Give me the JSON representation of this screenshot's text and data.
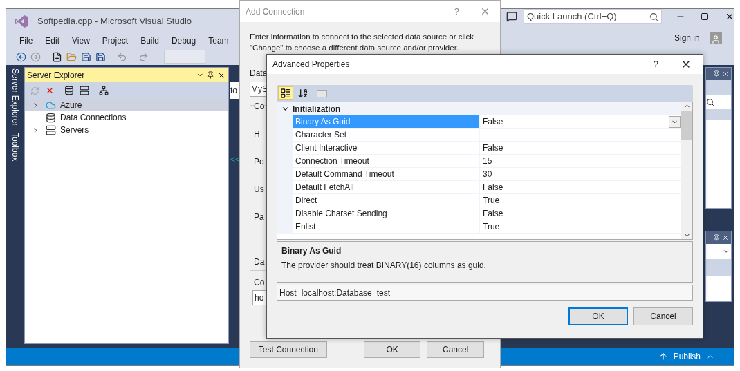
{
  "vs_window": {
    "title": "Softpedia.cpp - Microsoft Visual Studio",
    "quick_launch": {
      "placeholder": "Quick Launch (Ctrl+Q)"
    },
    "menu": [
      "File",
      "Edit",
      "View",
      "Project",
      "Build",
      "Debug",
      "Team"
    ],
    "sign_in": "Sign in",
    "side_tabs": [
      "Server Explorer",
      "Toolbox"
    ],
    "server_explorer": {
      "title": "Server Explorer",
      "tree": [
        {
          "label": "Azure",
          "kind": "cloud",
          "expandable": true,
          "selected": true
        },
        {
          "label": "Data Connections",
          "kind": "database",
          "expandable": false,
          "selected": false
        },
        {
          "label": "Servers",
          "kind": "server",
          "expandable": true,
          "selected": false
        }
      ]
    },
    "editor_fragments": [
      "to",
      "<<"
    ],
    "status_bar": {
      "publish": "Publish"
    }
  },
  "add_connection": {
    "title": "Add Connection",
    "help": "?",
    "intro": "Enter information to connect to the selected data source or click \"Change\" to choose a different data source and/or provider.",
    "data_source": {
      "label": "Data",
      "value": "MyS"
    },
    "group": {
      "title": "Co",
      "fields": [
        "H",
        "Po",
        "Us",
        "Pa",
        "Da"
      ]
    },
    "connection_string": {
      "label": "Co",
      "value": "ho"
    },
    "buttons": [
      "Test Connection",
      "OK",
      "Cancel"
    ]
  },
  "advanced_properties": {
    "title": "Advanced Properties",
    "help": "?",
    "toolbar": [
      {
        "kind": "categorized",
        "selected": true
      },
      {
        "kind": "alphabetical",
        "selected": false
      }
    ],
    "grid": {
      "category": "Initialization",
      "expanded": true,
      "rows": [
        {
          "name": "Binary As Guid",
          "value": "False",
          "selected": true
        },
        {
          "name": "Character Set",
          "value": "",
          "selected": false
        },
        {
          "name": "Client Interactive",
          "value": "False",
          "selected": false
        },
        {
          "name": "Connection Timeout",
          "value": "15",
          "selected": false
        },
        {
          "name": "Default Command Timeout",
          "value": "30",
          "selected": false
        },
        {
          "name": "Default FetchAll",
          "value": "False",
          "selected": false
        },
        {
          "name": "Direct",
          "value": "True",
          "selected": false
        },
        {
          "name": "Disable Charset Sending",
          "value": "False",
          "selected": false
        },
        {
          "name": "Enlist",
          "value": "True",
          "selected": false
        }
      ]
    },
    "description": {
      "title": "Binary As Guid",
      "text": "The provider should treat BINARY(16) columns as guid."
    },
    "connection_string": "Host=localhost;Database=test",
    "buttons": [
      {
        "label": "OK",
        "default": true
      },
      {
        "label": "Cancel",
        "default": false
      }
    ]
  }
}
